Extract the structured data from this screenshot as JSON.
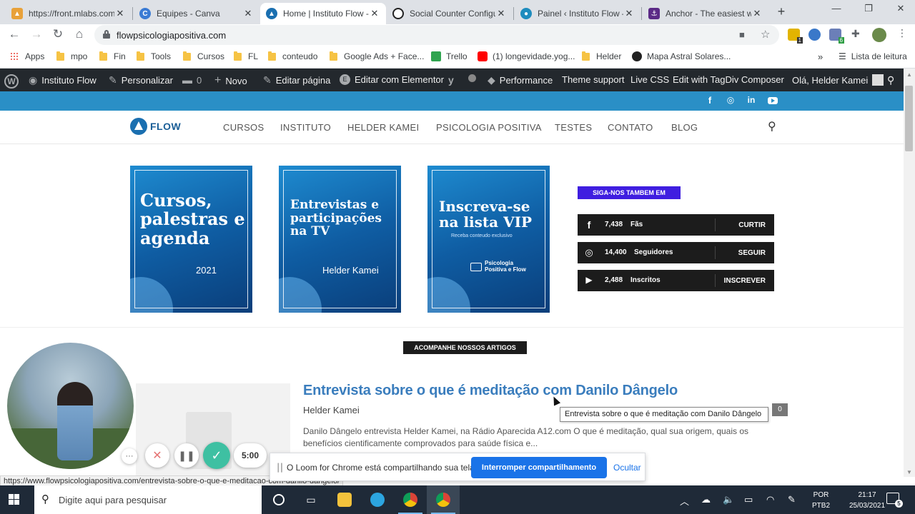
{
  "browser": {
    "tabs": [
      {
        "title": "https://front.mlabs.com",
        "color": "#e8a13a"
      },
      {
        "title": "Equipes - Canva",
        "color": "#3b7bd4"
      },
      {
        "title": "Home | Instituto Flow -",
        "color": "#1a6fb0"
      },
      {
        "title": "Social Counter Configu",
        "color": "#222222"
      },
      {
        "title": "Painel ‹ Instituto Flow —",
        "color": "#1e8cbe"
      },
      {
        "title": "Anchor - The easiest wa",
        "color": "#5b2a86"
      }
    ],
    "active_tab_index": 2,
    "url": "flowpsicologiapositiva.com",
    "bookmarks": [
      "Apps",
      "mpo",
      "Fin",
      "Tools",
      "Cursos",
      "FL",
      "conteudo",
      "Google Ads + Face...",
      "Trello",
      "(1) longevidade.yog...",
      "Helder",
      "Mapa Astral Solares..."
    ],
    "reading_list": "Lista de leitura",
    "extension_badges": [
      "1",
      "6"
    ]
  },
  "wp_admin": {
    "site_name": "Instituto Flow",
    "items": [
      "Personalizar",
      "0",
      "Novo",
      "Editar página",
      "Editar com Elementor",
      "Performance",
      "Theme support",
      "Live CSS",
      "Edit with TagDiv Composer"
    ],
    "greeting": "Olá, Helder Kamei"
  },
  "site": {
    "logo_text": "FLOW",
    "nav": [
      "CURSOS",
      "INSTITUTO",
      "HELDER KAMEI",
      "PSICOLOGIA POSITIVA",
      "TESTES",
      "CONTATO",
      "BLOG"
    ],
    "banners": [
      {
        "title": "Cursos, palestras e agenda",
        "subtitle": "2021"
      },
      {
        "title": "Entrevistas e participações na TV",
        "subtitle": "Helder Kamei"
      },
      {
        "title": "Inscreva-se na lista VIP",
        "tagline": "Receba conteudo exclusivo",
        "subtitle": "Psicologia Positiva e Flow"
      }
    ],
    "follow_label": "SIGA-NOS TAMBEM EM",
    "counters": [
      {
        "icon": "facebook-icon",
        "count": "7,438",
        "label": "Fãs",
        "button": "CURTIR"
      },
      {
        "icon": "instagram-icon",
        "count": "14,400",
        "label": "Seguidores",
        "button": "SEGUIR"
      },
      {
        "icon": "youtube-icon",
        "count": "2,488",
        "label": "Inscritos",
        "button": "INSCREVER"
      }
    ],
    "articles_label": "ACOMPANHE NOSSOS ARTIGOS",
    "article": {
      "title": "Entrevista sobre o que é meditação com Danilo Dângelo",
      "author": "Helder Kamei",
      "excerpt": "Danilo Dângelo entrevista Helder Kamei, na Rádio Aparecida A12.com O que é meditação, qual sua origem, quais os benefícios cientificamente comprovados para saúde física e...",
      "tooltip": "Entrevista sobre o que é meditação com Danilo Dângelo",
      "comments": "0"
    }
  },
  "status_url": "https://www.flowpsicologiapositiva.com/entrevista-sobre-o-que-e-meditacao-com-danilo-dangelo/",
  "loom": {
    "timer": "5:00",
    "message": "O Loom for Chrome está compartilhando sua tela.",
    "stop_label": "Interromper compartilhamento",
    "hide_label": "Ocultar"
  },
  "taskbar": {
    "search_placeholder": "Digite aqui para pesquisar",
    "lang_line1": "POR",
    "lang_line2": "PTB2",
    "time": "21:17",
    "date": "25/03/2021",
    "notifications": "5"
  },
  "colors": {
    "wp_admin_bg": "#23282d",
    "brand_blue": "#2a8fc6",
    "follow_label_bg": "#3f1ee0",
    "article_title": "#3a7dbd",
    "loom_stop": "#1a73e8"
  }
}
